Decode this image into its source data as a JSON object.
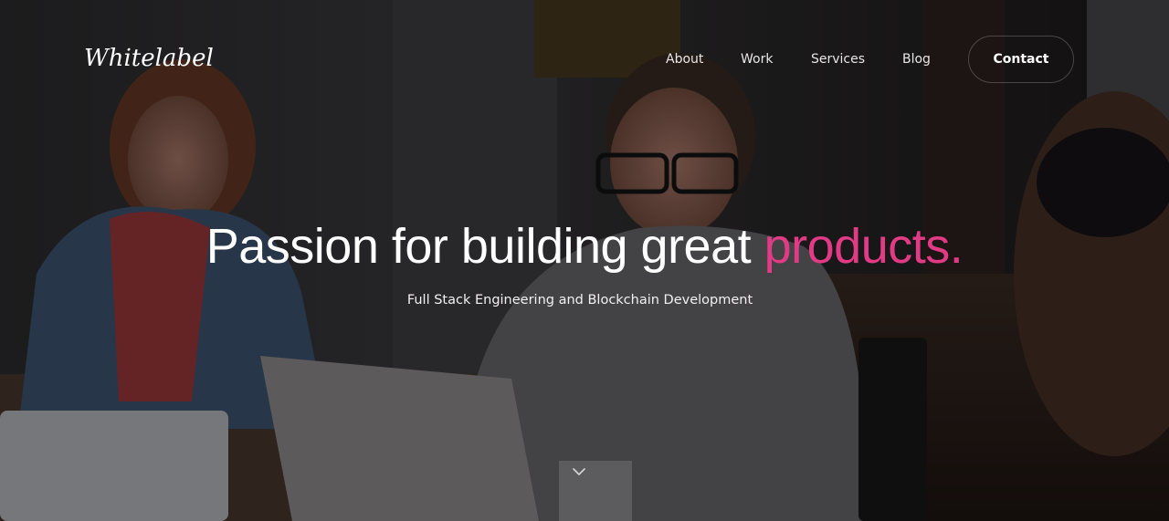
{
  "header": {
    "logo_text": "Whitelabel",
    "nav": [
      {
        "label": "About"
      },
      {
        "label": "Work"
      },
      {
        "label": "Services"
      },
      {
        "label": "Blog"
      }
    ],
    "contact_label": "Contact"
  },
  "hero": {
    "headline_main": "Passion for building great ",
    "headline_accent": "products.",
    "subheadline": "Full Stack Engineering and Blockchain Development",
    "scroll_icon": "chevron-down-icon"
  },
  "colors": {
    "accent": "#e23b86",
    "text": "#ffffff",
    "overlay": "#08080a"
  }
}
